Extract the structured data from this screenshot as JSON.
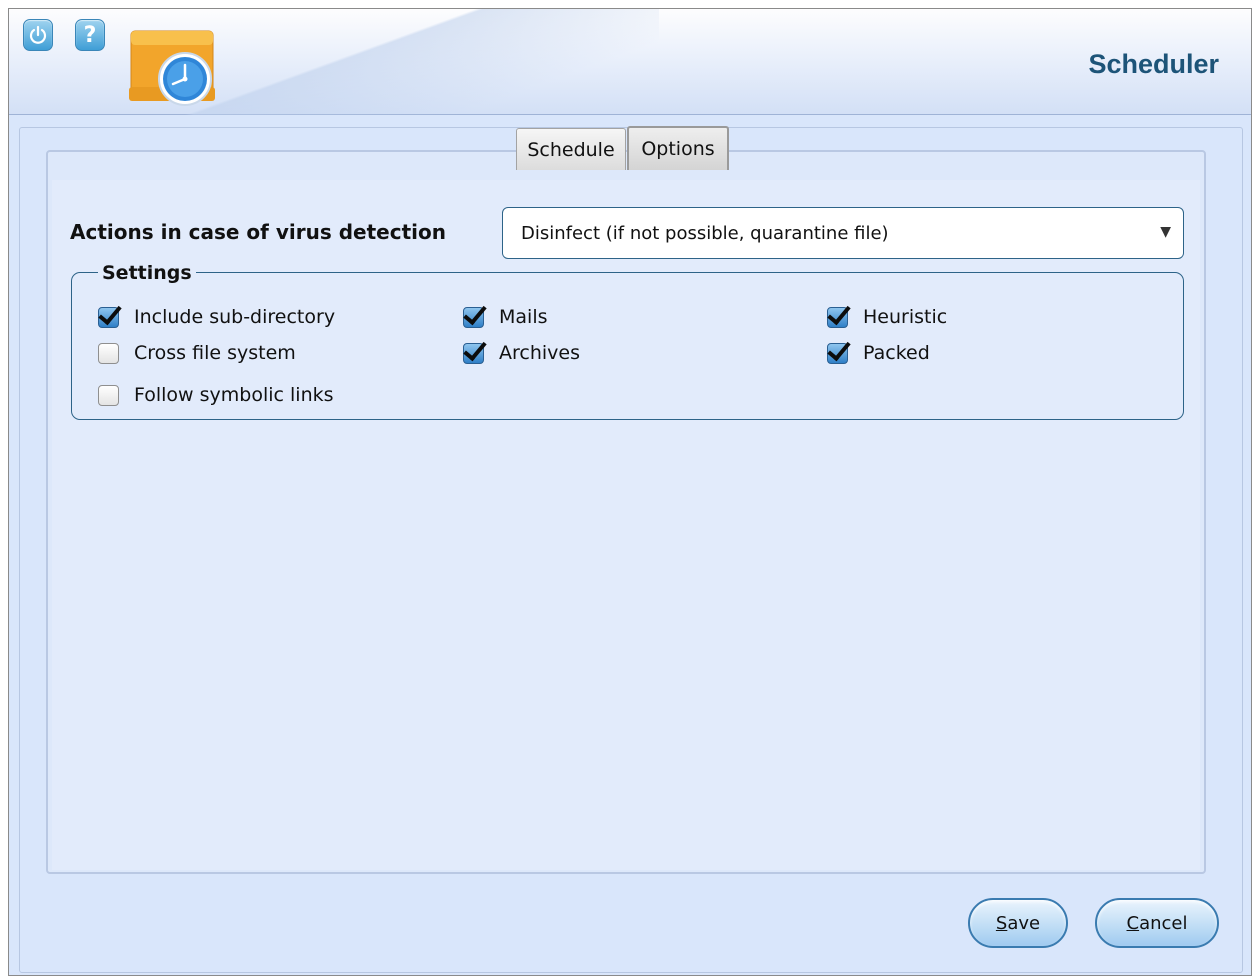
{
  "header": {
    "title": "Scheduler",
    "power_icon": "power-icon",
    "help_icon": "help-icon",
    "help_glyph": "?",
    "logo_icon": "scheduler-clock-icon"
  },
  "tabs": [
    {
      "label": "Schedule",
      "selected": false
    },
    {
      "label": "Options",
      "selected": true
    }
  ],
  "options": {
    "action_label": "Actions in case of virus detection",
    "action_value": "Disinfect (if not possible, quarantine file)",
    "settings_legend": "Settings",
    "checkboxes": [
      {
        "label": "Include sub-directory",
        "checked": true
      },
      {
        "label": "Cross file system",
        "checked": false
      },
      {
        "label": "Follow symbolic links",
        "checked": false
      },
      {
        "label": "Mails",
        "checked": true
      },
      {
        "label": "Archives",
        "checked": true
      },
      {
        "label": "Heuristic",
        "checked": true
      },
      {
        "label": "Packed",
        "checked": true
      }
    ]
  },
  "buttons": {
    "save": {
      "mnemonic": "S",
      "rest": "ave"
    },
    "cancel": {
      "mnemonic": "C",
      "rest": "ancel"
    }
  },
  "colors": {
    "title": "#1d5478",
    "accent_border": "#2d6388",
    "panel_bg": "#e2ebfb"
  }
}
